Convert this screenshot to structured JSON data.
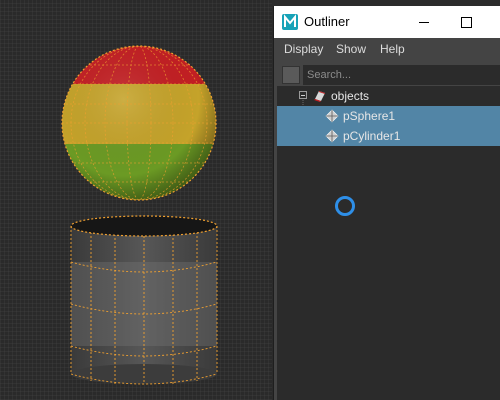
{
  "outliner": {
    "title": "Outliner",
    "menu": [
      "Display",
      "Show",
      "Help"
    ],
    "search_placeholder": "Search...",
    "items": [
      {
        "label": "objects",
        "selected": false
      },
      {
        "label": "pSphere1",
        "selected": true
      },
      {
        "label": "pCylinder1",
        "selected": true
      }
    ]
  },
  "icons": {
    "app": "maya-logo-icon",
    "minimize": "minimize-icon",
    "maximize": "maximize-icon",
    "filter": "filter-icon",
    "set": "object-set-icon",
    "transform": "transform-node-icon",
    "busy": "busy-cursor-icon"
  },
  "colors": {
    "selection": "#5285a6",
    "wireframe_highlight": "#f0a030",
    "sphere_bands": [
      "#c21f23",
      "#c5a32a",
      "#6b9a24"
    ],
    "busy_cursor": "#2e8fe8"
  }
}
